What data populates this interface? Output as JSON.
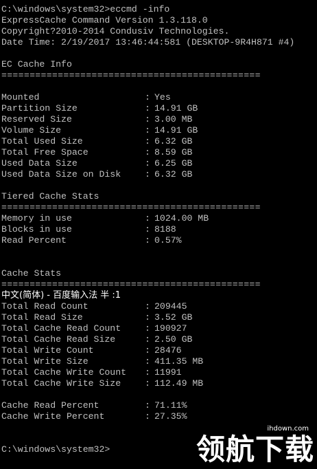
{
  "console": {
    "prompt_command": "C:\\windows\\system32>eccmd -info",
    "version_line": "ExpressCache Command Version 1.3.118.0",
    "copyright_line": "Copyright?2010-2014 Condusiv Technologies.",
    "datetime_line": "Date Time: 2/19/2017 13:46:44:581 (DESKTOP-9R4H871 #4)",
    "ec_cache_info": {
      "title": "EC Cache Info",
      "separator": "==============================================",
      "rows": [
        {
          "key": "Mounted",
          "value": "Yes"
        },
        {
          "key": "Partition Size",
          "value": "14.91 GB"
        },
        {
          "key": "Reserved Size",
          "value": "3.00 MB"
        },
        {
          "key": "Volume Size",
          "value": "14.91 GB"
        },
        {
          "key": "Total Used Size",
          "value": "6.32 GB"
        },
        {
          "key": "Total Free Space",
          "value": "8.59 GB"
        },
        {
          "key": "Used Data Size",
          "value": "6.25 GB"
        },
        {
          "key": "Used Data Size on Disk",
          "value": "6.32 GB"
        }
      ]
    },
    "tiered_cache_stats": {
      "title": "Tiered Cache Stats",
      "separator": "==============================================",
      "rows": [
        {
          "key": "Memory in use",
          "value": "1024.00 MB"
        },
        {
          "key": "Blocks in use",
          "value": "8188"
        },
        {
          "key": "Read Percent",
          "value": "0.57%"
        }
      ]
    },
    "cache_stats": {
      "title": "Cache Stats",
      "separator": "==============================================",
      "ime_status": "中文(简体) - 百度输入法 半 :1",
      "rows": [
        {
          "key": "Total Read Count",
          "value": "209445"
        },
        {
          "key": "Total Read Size",
          "value": "3.52 GB"
        },
        {
          "key": "Total Cache Read Count",
          "value": "190927"
        },
        {
          "key": "Total Cache Read Size",
          "value": "2.50 GB"
        },
        {
          "key": "Total Write Count",
          "value": "28476"
        },
        {
          "key": "Total Write Size",
          "value": "411.35 MB"
        },
        {
          "key": "Total Cache Write Count",
          "value": "11991"
        },
        {
          "key": "Total Cache Write Size",
          "value": "112.49 MB"
        }
      ],
      "percent_rows": [
        {
          "key": "Cache Read Percent",
          "value": "71.11%"
        },
        {
          "key": "Cache Write Percent",
          "value": "27.35%"
        }
      ]
    },
    "final_prompt": "C:\\windows\\system32>",
    "colon": ":"
  },
  "watermark": {
    "url": "ihdown.com",
    "text": "领航下载"
  }
}
